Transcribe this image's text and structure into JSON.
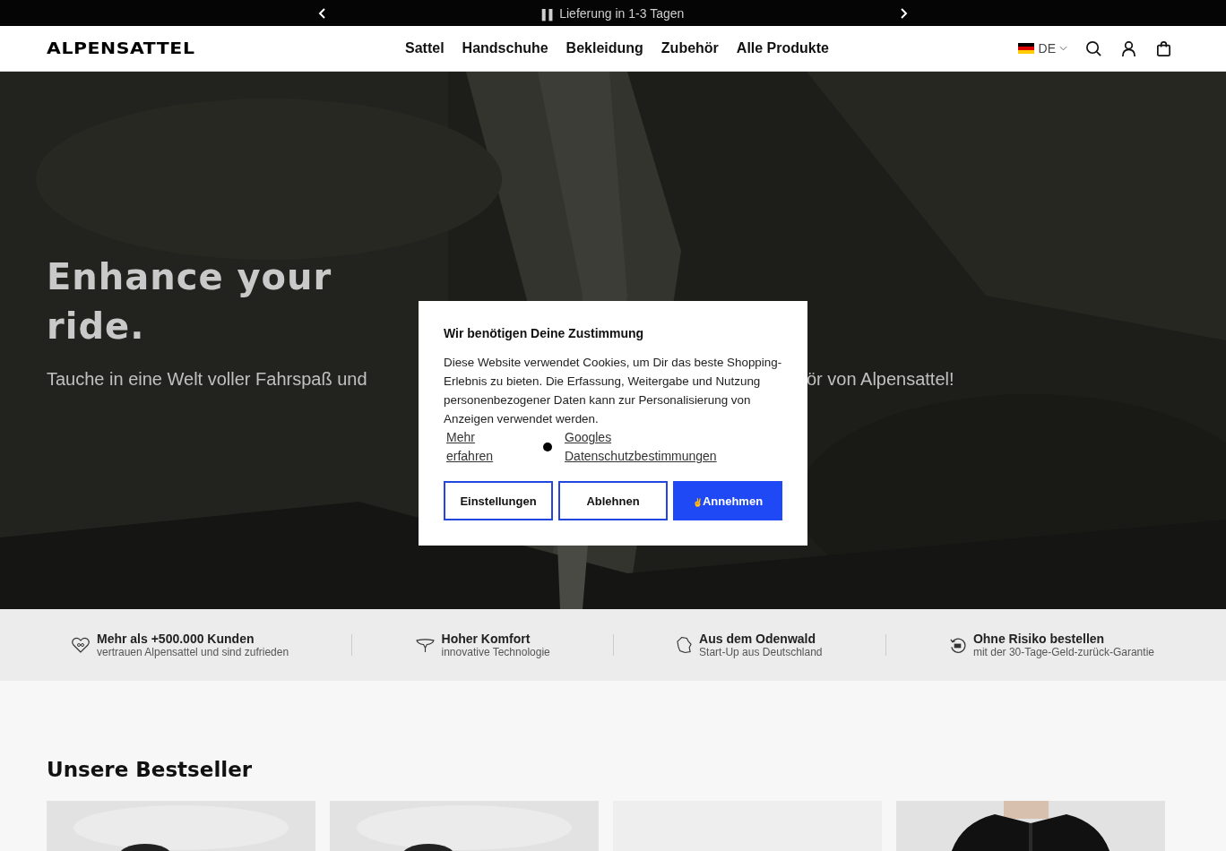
{
  "announcement": {
    "text": "Lieferung in 1-3 Tagen",
    "icon": "▌▌"
  },
  "header": {
    "logo": "ALPENSATTEL",
    "nav": [
      {
        "label": "Sattel"
      },
      {
        "label": "Handschuhe"
      },
      {
        "label": "Bekleidung"
      },
      {
        "label": "Zubehör"
      },
      {
        "label": "Alle Produkte"
      }
    ],
    "language": "DE"
  },
  "hero": {
    "kind": "picture",
    "title_lines": [
      "Enhance your",
      "ride."
    ],
    "subtitle_left": "Tauche in eine Welt voller Fahrspaß und",
    "subtitle_right": "ör von Alpensattel!"
  },
  "features": [
    {
      "kind": "heart",
      "title": "Mehr als +500.000 Kunden",
      "subtitle": "vertrauen Alpensattel und sind zufrieden"
    },
    {
      "kind": "saddle",
      "title": "Hoher Komfort",
      "subtitle": "innovative Technologie"
    },
    {
      "kind": "map",
      "title": "Aus dem Odenwald",
      "subtitle": "Start-Up aus Deutschland"
    },
    {
      "kind": "return",
      "title": "Ohne Risiko bestellen",
      "subtitle": "mit der 30-Tage-Geld-zurück-Garantie"
    }
  ],
  "bestsellers": {
    "title": "Unsere Bestseller",
    "products": [
      {
        "kind": "saddle"
      },
      {
        "kind": "saddle"
      },
      {
        "kind": "empty"
      },
      {
        "kind": "jacket"
      }
    ]
  },
  "consent": {
    "title": "Wir benötigen Deine Zustimmung",
    "text": "Diese Website verwendet Cookies, um Dir das beste Shopping-Erlebnis zu bieten. Die Erfassung, Weitergabe und Nutzung personenbezogener Daten kann zur Personalisierung von Anzeigen verwendet werden.",
    "links": [
      "Mehr erfahren",
      "Googles Datenschutzbestimmungen"
    ],
    "buttons": [
      {
        "label": "Einstellungen",
        "kind": "outline"
      },
      {
        "label": "Ablehnen",
        "kind": "outline"
      },
      {
        "label": "Annehmen",
        "kind": "primary",
        "icon": "✌"
      }
    ]
  }
}
